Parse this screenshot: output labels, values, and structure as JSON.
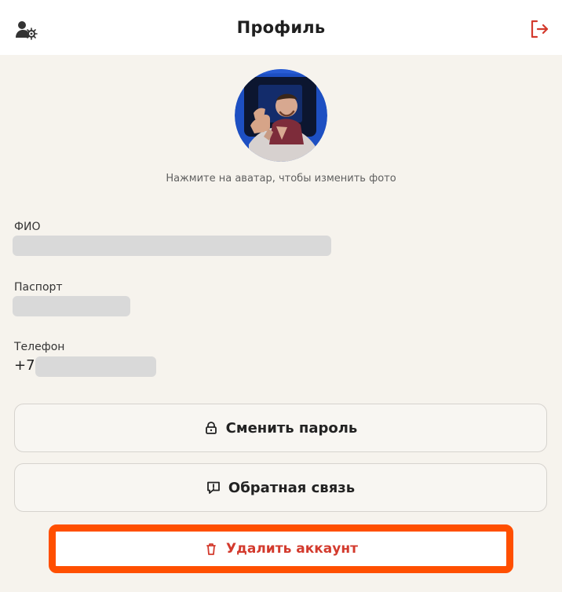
{
  "header": {
    "title": "Профиль",
    "left_icon": "profile-settings-icon",
    "right_icon": "logout-icon"
  },
  "avatar": {
    "hint": "Нажмите на аватар, чтобы изменить фото"
  },
  "fields": {
    "fio": {
      "label": "ФИО",
      "value": ""
    },
    "passport": {
      "label": "Паспорт",
      "value": ""
    },
    "phone": {
      "label": "Телефон",
      "prefix": "+7",
      "value": ""
    }
  },
  "buttons": {
    "change_password": "Сменить пароль",
    "feedback": "Обратная связь",
    "delete_account": "Удалить аккаунт"
  },
  "colors": {
    "background": "#f6f3ed",
    "header": "#ffffff",
    "accent_red": "#d33a2d",
    "highlight_orange": "#ff4f00",
    "placeholder": "#d9d9d9"
  }
}
